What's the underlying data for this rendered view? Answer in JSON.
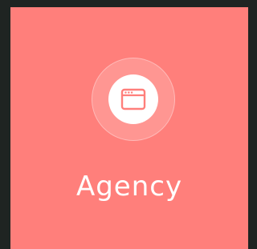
{
  "card": {
    "title": "Agency",
    "icon": "browser-window-icon",
    "background_color": "#ff7f7b",
    "text_color": "#ffffff"
  }
}
